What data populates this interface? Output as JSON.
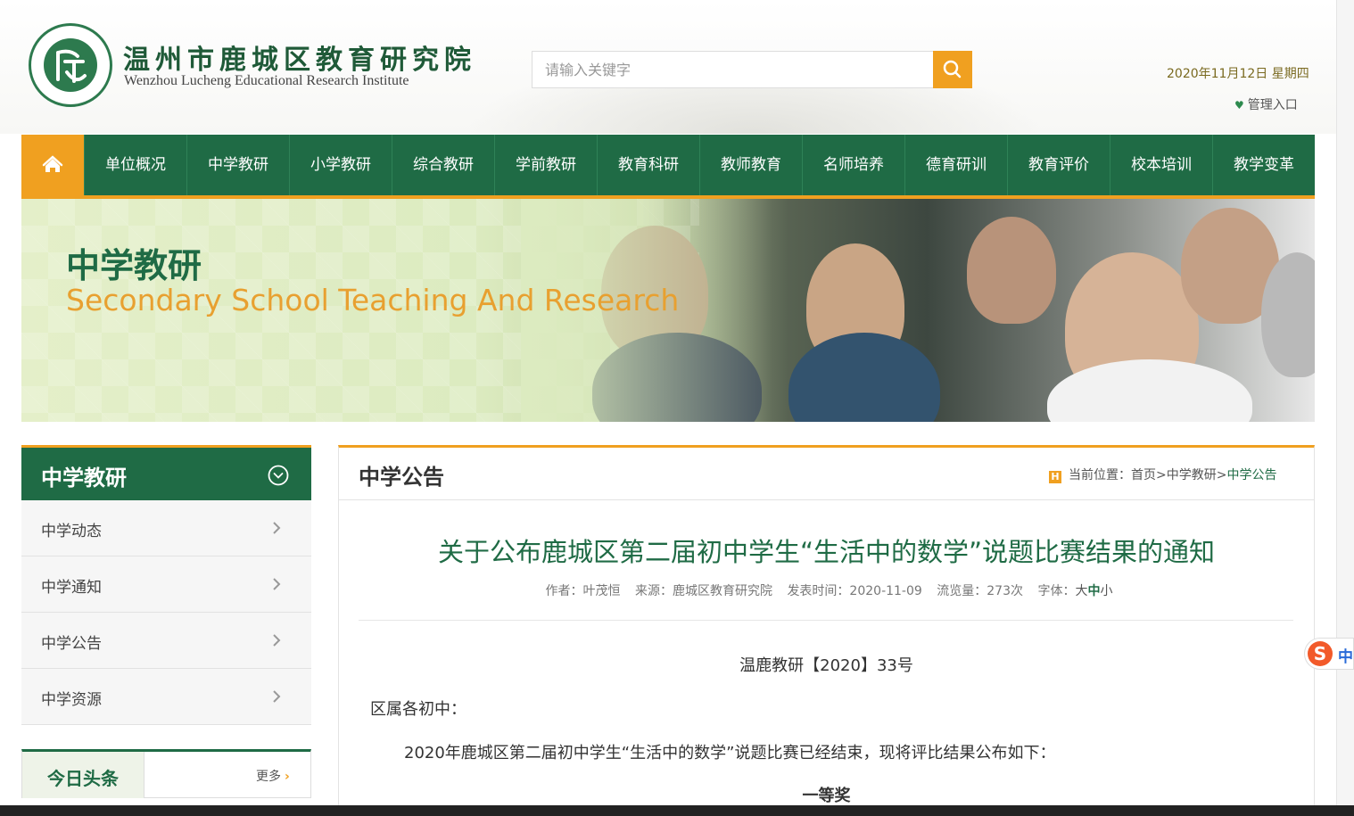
{
  "site": {
    "name_cn": "温州市鹿城区教育研究院",
    "name_en": "Wenzhou Lucheng Educational Research Institute"
  },
  "search": {
    "placeholder": "请输入关键字",
    "icon": "search-icon"
  },
  "date": "2020年11月12日 星期四",
  "admin_link": "管理入口",
  "nav": {
    "home_icon": "home-icon",
    "items": [
      "单位概况",
      "中学教研",
      "小学教研",
      "综合教研",
      "学前教研",
      "教育科研",
      "教师教育",
      "名师培养",
      "德育研训",
      "教育评价",
      "校本培训",
      "教学变革"
    ]
  },
  "banner": {
    "title_cn": "中学教研",
    "title_en": "Secondary School Teaching And Research"
  },
  "sidebar": {
    "title": "中学教研",
    "items": [
      "中学动态",
      "中学通知",
      "中学公告",
      "中学资源"
    ],
    "news_tab": "今日头条",
    "more": "更多"
  },
  "main": {
    "section_title": "中学公告",
    "breadcrumb": {
      "prefix": "当前位置：",
      "home": "首页",
      "sep": ">",
      "level1": "中学教研",
      "current": "中学公告"
    },
    "article": {
      "title": "关于公布鹿城区第二届初中学生“生活中的数学”说题比赛结果的通知",
      "meta": {
        "author": "作者：叶茂恒",
        "source": "来源：鹿城区教育研究院",
        "published": "发表时间：2020-11-09",
        "views": "流览量：273次",
        "font_label": "字体：",
        "font_big": "大",
        "font_mid": "中",
        "font_small": "小"
      },
      "doc_no": "温鹿教研【2020】33号",
      "salutation": "区属各初中：",
      "paragraph": "2020年鹿城区第二届初中学生“生活中的数学”说题比赛已经结束，现将评比结果公布如下：",
      "heading": "一等奖"
    }
  },
  "ime": {
    "logo": "S",
    "label": "中"
  },
  "colors": {
    "green": "#1f6b45",
    "orange": "#f0a020",
    "title_green": "#1f6b45"
  }
}
